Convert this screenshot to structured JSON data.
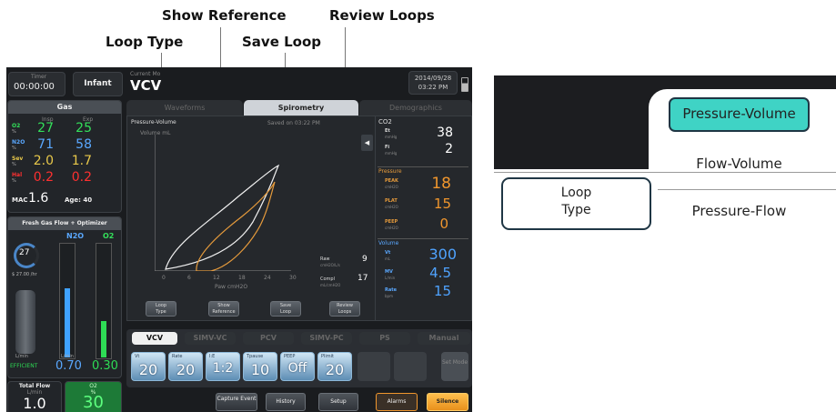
{
  "callouts": {
    "show_reference": "Show Reference",
    "review_loops": "Review Loops",
    "loop_type": "Loop Type",
    "save_loop": "Save Loop"
  },
  "screen": {
    "header": {
      "timer_label": "Timer",
      "timer_value": "00:00:00",
      "patient_type": "Infant",
      "current_mode_label": "Current Mo",
      "current_mode": "VCV",
      "date": "2014/09/28",
      "time": "03:22 PM"
    },
    "gas": {
      "title": "Gas",
      "col_insp": "Insp",
      "col_exp": "Exp",
      "rows": [
        {
          "agent": "O2",
          "unit": "%",
          "insp": "27",
          "exp": "25",
          "color": "#33e05a"
        },
        {
          "agent": "N2O",
          "unit": "%",
          "insp": "71",
          "exp": "58",
          "color": "#5aa8ff"
        },
        {
          "agent": "Sev",
          "unit": "%",
          "insp": "2.0",
          "exp": "1.7",
          "color": "#e8c84a"
        },
        {
          "agent": "Hal",
          "unit": "%",
          "insp": "0.2",
          "exp": "0.2",
          "color": "#ff3030"
        }
      ],
      "mac_label": "MAC",
      "mac_value": "1.6",
      "age_label": "Age: 40"
    },
    "fresh_gas": {
      "title": "Fresh Gas Flow + Optimizer",
      "gauge_value": "27",
      "gauge_sub": "$ 27.00 /hr",
      "col_n2o": "N2O",
      "col_o2": "O2",
      "lmin": "L/min",
      "n2o_flow": "0.70",
      "o2_flow": "0.30",
      "efficiency": "EFFICIENT"
    },
    "totals": {
      "total_flow_label": "Total Flow",
      "total_flow_unit": "L/min",
      "total_flow_value": "1.0",
      "o2_label": "O2",
      "o2_unit": "%",
      "o2_value": "30"
    },
    "tabs": [
      "Waveforms",
      "Spirometry",
      "Demographics"
    ],
    "spirometry": {
      "plot_title": "Pressure-Volume",
      "saved_label": "Saved on 03:22 PM",
      "y_axis_label": "Volume mL",
      "x_axis_label": "Paw cmH2O",
      "x_ticks": [
        "0",
        "6",
        "12",
        "18",
        "24",
        "30"
      ],
      "raw_label": "Raw",
      "raw_unit": "cmH2O/L/s",
      "raw_value": "9",
      "compl_label": "Compl",
      "compl_unit": "mL/cmH2O",
      "compl_value": "17",
      "buttons": [
        {
          "line1": "Loop",
          "line2": "Type"
        },
        {
          "line1": "Show",
          "line2": "Reference"
        },
        {
          "line1": "Save",
          "line2": "Loop"
        },
        {
          "line1": "Review",
          "line2": "Loops"
        }
      ]
    },
    "readings": {
      "co2_title": "CO2",
      "et_label": "Et",
      "et_unit": "mmHg",
      "et_value": "38",
      "fi_label": "Fi",
      "fi_unit": "mmHg",
      "fi_value": "2",
      "pressure_title": "Pressure",
      "peak_label": "PEAK",
      "peak_value": "18",
      "plat_label": "PLAT",
      "plat_value": "15",
      "peep_label": "PEEP",
      "peep_value": "0",
      "p_unit": "cmH2O",
      "volume_title": "Volume",
      "vt_label": "Vt",
      "vt_unit": "mL",
      "vt_value": "300",
      "mv_label": "MV",
      "mv_unit": "L/min",
      "mv_value": "4.5",
      "rate_label": "Rate",
      "rate_unit": "bpm",
      "rate_value": "15"
    },
    "modes": [
      "VCV",
      "SIMV-VC",
      "PCV",
      "SIMV-PC",
      "PS",
      "Manual"
    ],
    "params": [
      {
        "label": "Vt",
        "value": "20",
        "unit": "mL"
      },
      {
        "label": "Rate",
        "value": "20",
        "unit": "bpm"
      },
      {
        "label": "I:E",
        "value": "1:2",
        "unit": ""
      },
      {
        "label": "Tpause",
        "value": "10",
        "unit": "%"
      },
      {
        "label": "PEEP",
        "value": "Off",
        "unit": "cmH2O"
      },
      {
        "label": "Plimit",
        "value": "20",
        "unit": "cmH2O"
      }
    ],
    "set_mode_label": "Set Mode",
    "bottom_buttons": [
      {
        "label": "Capture Event"
      },
      {
        "label": "History"
      },
      {
        "label": "Setup"
      },
      {
        "label": "Alarms"
      },
      {
        "label": "Silence"
      }
    ]
  },
  "loop_menu": {
    "options": [
      "Pressure-Volume",
      "Flow-Volume",
      "Pressure-Flow"
    ],
    "selected": "Pressure-Volume",
    "button_line1": "Loop",
    "button_line2": "Type",
    "accent": "#3fd3c5"
  }
}
